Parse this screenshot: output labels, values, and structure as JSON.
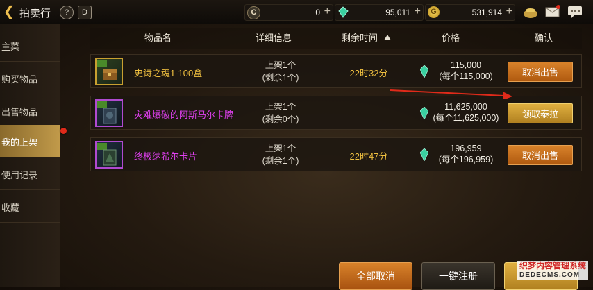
{
  "header": {
    "title": "拍卖行",
    "help_icon_label": "?",
    "info_icon_label": "D"
  },
  "currencies": [
    {
      "icon": "c-coin-icon",
      "value": "0"
    },
    {
      "icon": "gem-icon",
      "value": "95,011"
    },
    {
      "icon": "gold-coin-icon",
      "value": "531,914"
    }
  ],
  "sidebar": {
    "items": [
      {
        "label": "主菜"
      },
      {
        "label": "购买物品"
      },
      {
        "label": "出售物品"
      },
      {
        "label": "我的上架"
      },
      {
        "label": "使用记录"
      },
      {
        "label": "收藏"
      }
    ]
  },
  "table": {
    "headers": {
      "name": "物品名",
      "detail": "详细信息",
      "time": "剩余时间",
      "price": "价格",
      "confirm": "确认"
    },
    "rows": [
      {
        "name": "史诗之魂1-100盒",
        "name_color": "#f0c040",
        "detail1": "上架1个",
        "detail2": "(剩余1个)",
        "time": "22时32分",
        "price1": "115,000",
        "price2": "(每个115,000)",
        "action": "取消出售"
      },
      {
        "name": "灾难爆破的阿斯马尔卡牌",
        "name_color": "#e040f0",
        "detail1": "上架1个",
        "detail2": "(剩余0个)",
        "time": "",
        "price1": "11,625,000",
        "price2": "(每个11,625,000)",
        "action": "领取泰拉"
      },
      {
        "name": "终极纳希尔卡片",
        "name_color": "#e040f0",
        "detail1": "上架1个",
        "detail2": "(剩余1个)",
        "time": "22时47分",
        "price1": "196,959",
        "price2": "(每个196,959)",
        "action": "取消出售"
      }
    ]
  },
  "footer": {
    "cancel_all": "全部取消",
    "one_click": "一键注册"
  },
  "watermark": {
    "cn": "织梦内容管理系统",
    "en": "DEDECMS.COM"
  },
  "colors": {
    "accent_orange": "#c86a1c",
    "active_tab": "#b48a3c",
    "gold_text": "#f0c040",
    "purple_text": "#e040f0"
  }
}
